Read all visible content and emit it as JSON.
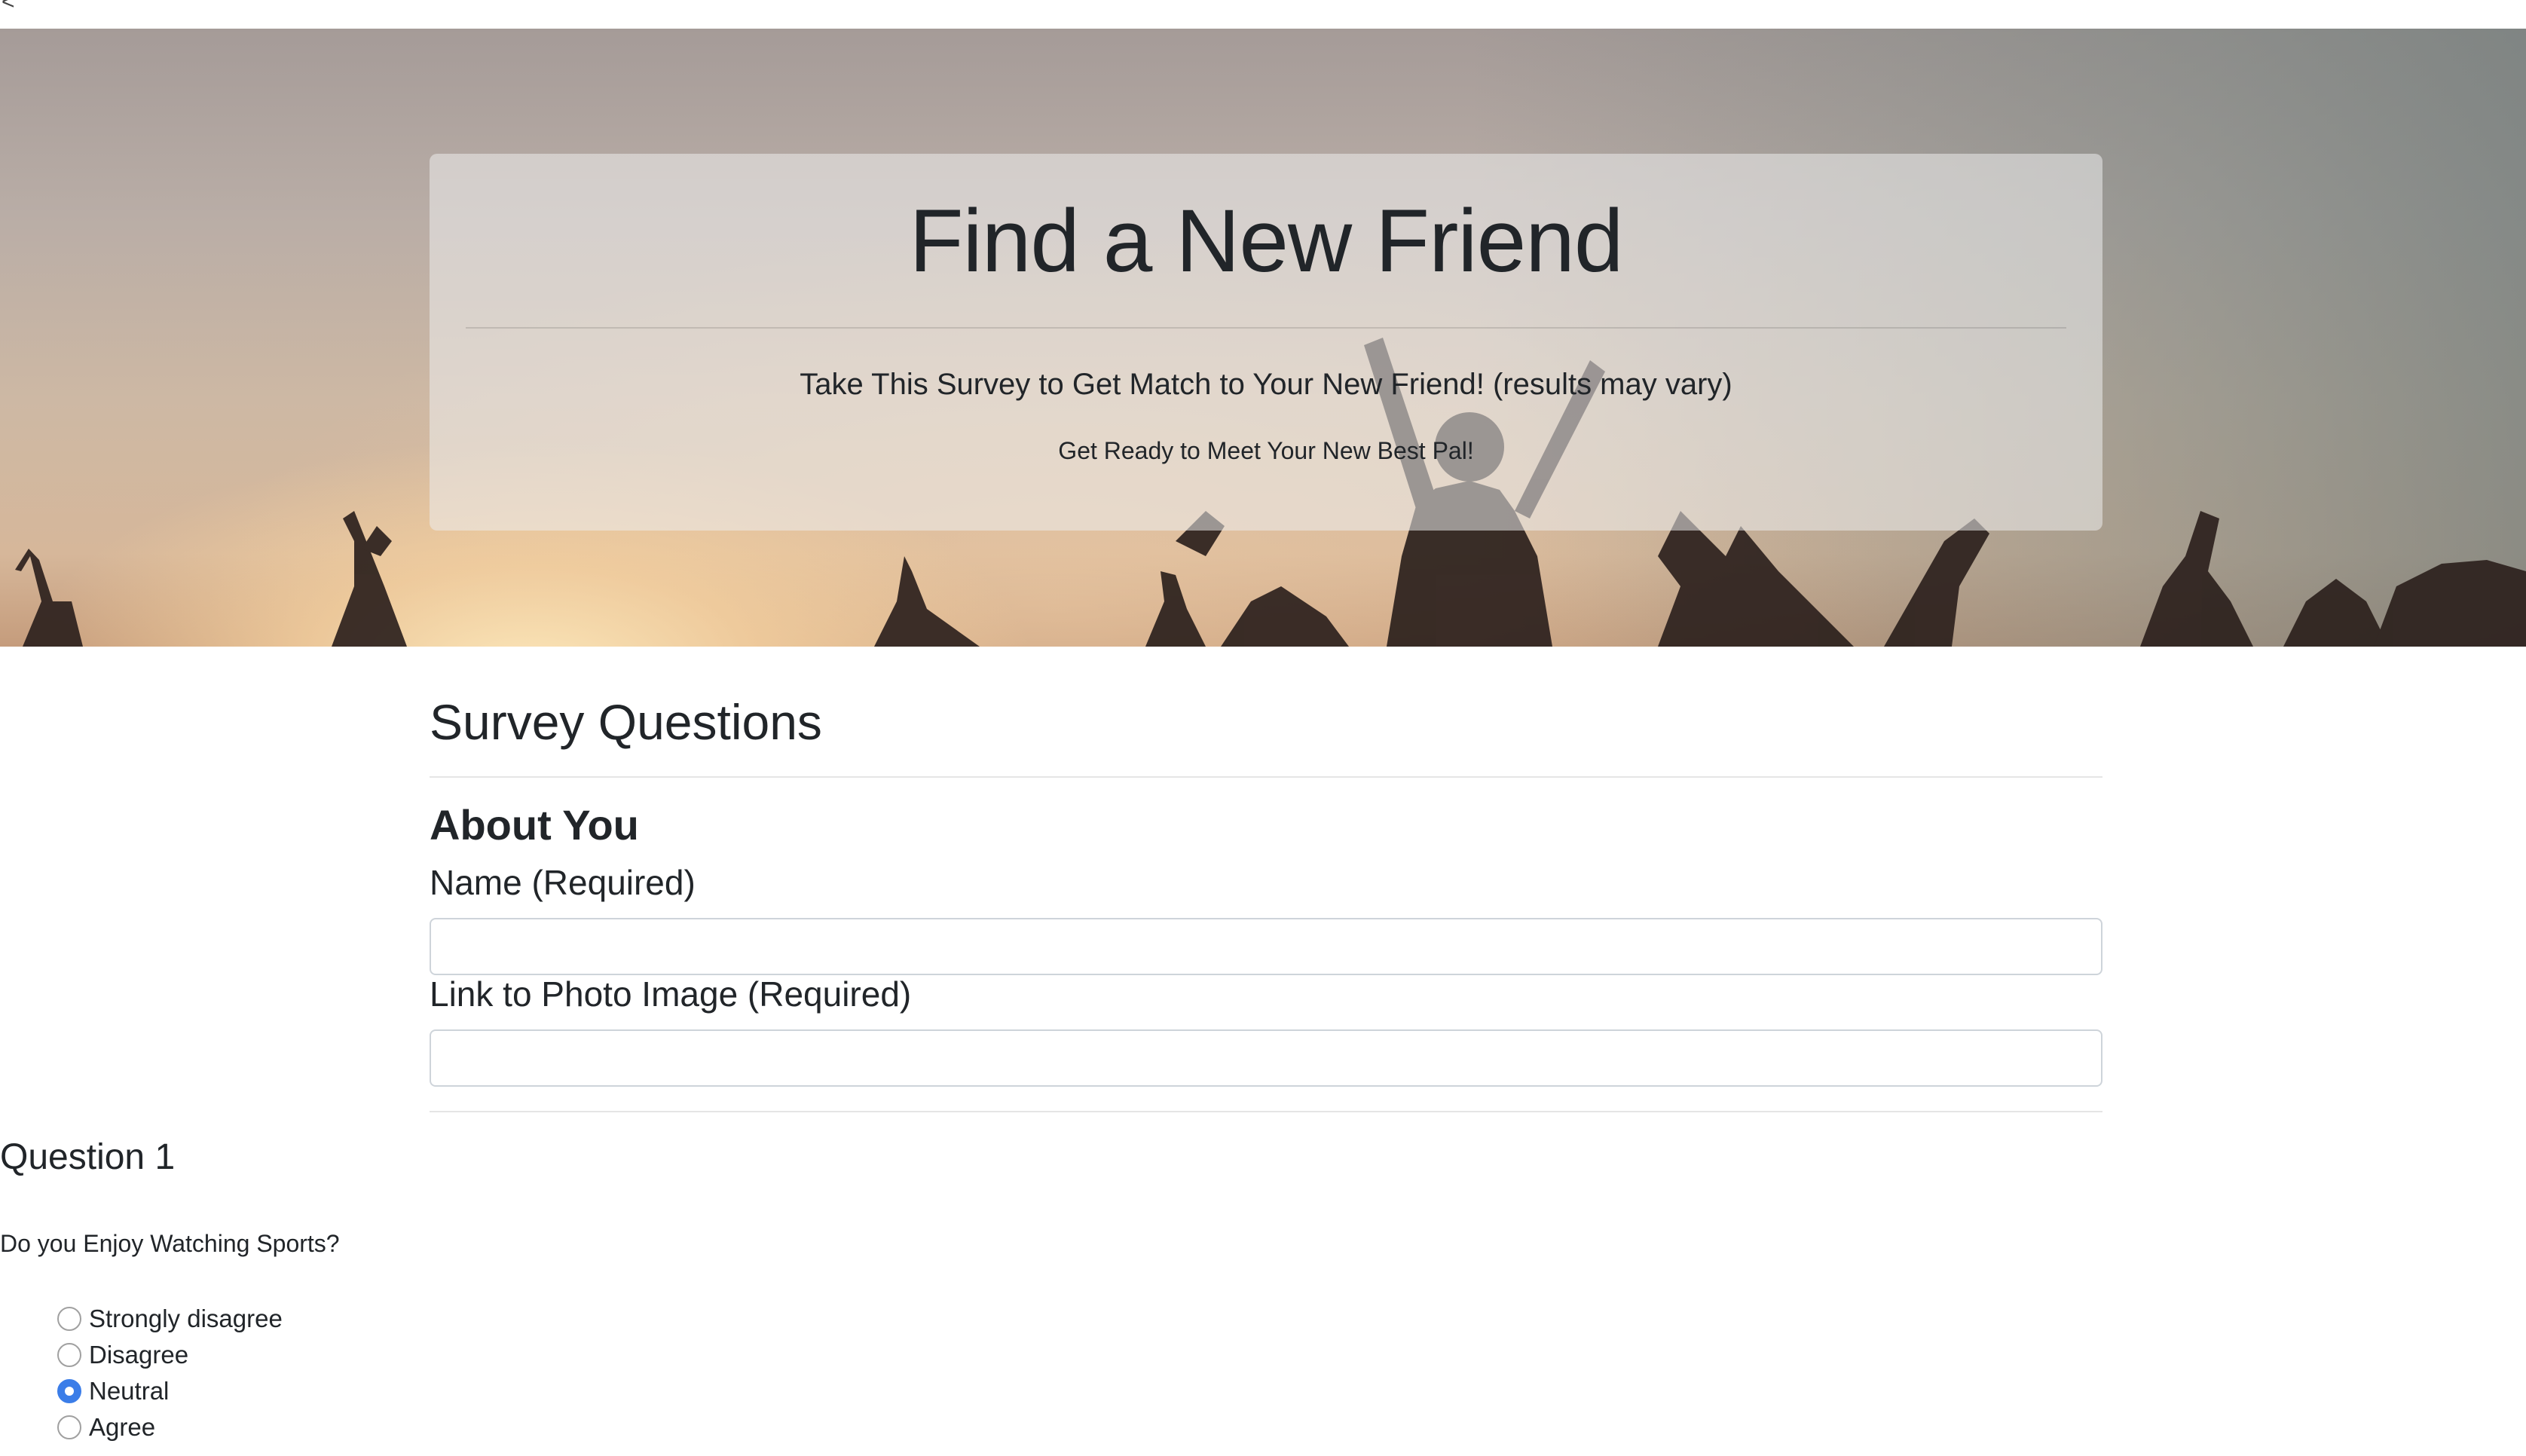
{
  "page": {
    "top_glyph": "<"
  },
  "hero": {
    "title": "Find a New Friend",
    "lead": "Take This Survey to Get Match to Your New Friend! (results may vary)",
    "subtext": "Get Ready to Meet Your New Best Pal!"
  },
  "survey": {
    "title": "Survey Questions",
    "about_heading": "About You",
    "name_label": "Name (Required)",
    "name_value": "",
    "photo_label": "Link to Photo Image (Required)",
    "photo_value": ""
  },
  "question1": {
    "title": "Question 1",
    "text": "Do you Enjoy Watching Sports?",
    "options": [
      {
        "label": "Strongly disagree",
        "checked": false
      },
      {
        "label": "Disagree",
        "checked": false
      },
      {
        "label": "Neutral",
        "checked": true
      },
      {
        "label": "Agree",
        "checked": false
      }
    ],
    "selected": "Neutral"
  },
  "colors": {
    "radio_accent": "#3b7de8",
    "text": "#212529",
    "input_border": "#ced4da"
  }
}
